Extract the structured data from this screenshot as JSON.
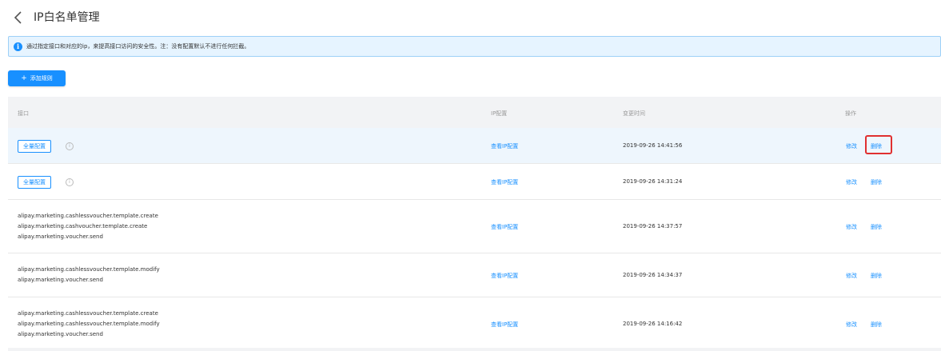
{
  "header": {
    "title": "IP白名单管理"
  },
  "notice": {
    "text": "通过指定接口和对应的ip，来提高接口访问的安全性。注：没有配置默认不进行任何拦截。"
  },
  "toolbar": {
    "add_label": "添加规则",
    "add_icon": "+"
  },
  "table": {
    "headers": [
      "接口",
      "IP配置",
      "变更时间",
      "操作"
    ],
    "rows": [
      {
        "tag": "全量配置",
        "ip_link": "查看IP配置",
        "time": "2019-09-26 14:41:56",
        "edit": "修改",
        "delete": "删除"
      },
      {
        "tag": "全量配置",
        "ip_link": "查看IP配置",
        "time": "2019-09-26 14:31:24",
        "edit": "修改",
        "delete": "删除"
      },
      {
        "lines": [
          "alipay.marketing.cashlessvoucher.template.create",
          "alipay.marketing.cashvoucher.template.create",
          "alipay.marketing.voucher.send"
        ],
        "ip_link": "查看IP配置",
        "time": "2019-09-26 14:37:57",
        "edit": "修改",
        "delete": "删除"
      },
      {
        "lines": [
          "alipay.marketing.cashlessvoucher.template.modify",
          "alipay.marketing.voucher.send"
        ],
        "ip_link": "查看IP配置",
        "time": "2019-09-26 14:34:37",
        "edit": "修改",
        "delete": "删除"
      },
      {
        "lines": [
          "alipay.marketing.cashlessvoucher.template.create",
          "alipay.marketing.cashlessvoucher.template.modify",
          "alipay.marketing.voucher.send"
        ],
        "ip_link": "查看IP配置",
        "time": "2019-09-26 14:16:42",
        "edit": "修改",
        "delete": "删除"
      }
    ]
  },
  "colors": {
    "accent": "#1890ff",
    "highlight_border": "#e03030"
  }
}
